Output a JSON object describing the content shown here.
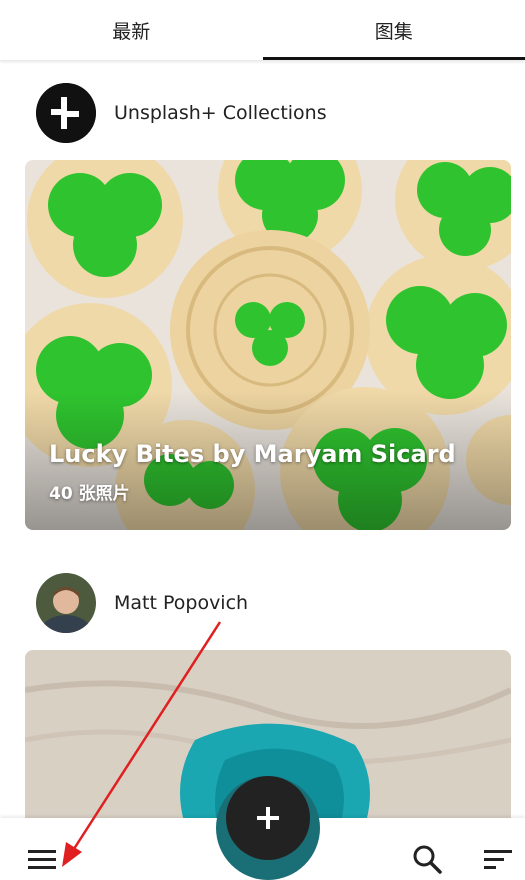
{
  "tabs": [
    {
      "label": "最新",
      "active": false
    },
    {
      "label": "图集",
      "active": true
    }
  ],
  "feed": {
    "items": [
      {
        "owner": "Unsplash+ Collections",
        "avatar": "unsplash-plus-logo",
        "card": {
          "title": "Lucky Bites by Maryam Sicard",
          "subtitle": "40 张照片",
          "image": "shamrock-cookies-photo"
        }
      },
      {
        "owner": "Matt Popovich",
        "avatar": "user-photo",
        "card": {
          "image": "aerial-teal-pool-photo"
        }
      }
    ]
  },
  "bottom_bar": {
    "menu_icon": "menu-icon",
    "add_icon": "plus-icon",
    "search_icon": "search-icon",
    "sort_icon": "sort-icon"
  },
  "colors": {
    "accent": "#1a6e75",
    "fab": "#222222",
    "annotation": "#e02020"
  }
}
